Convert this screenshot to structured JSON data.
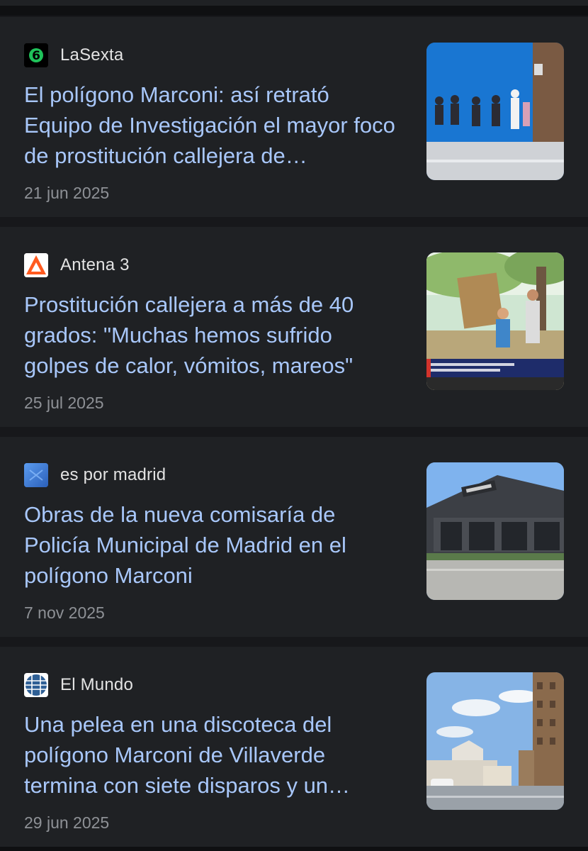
{
  "articles": [
    {
      "publisher": "LaSexta",
      "logo_icon": "lasexta-logo-icon",
      "headline": "El polígono Marconi: así retrató Equipo de Investigación el mayor foco de prostitución callejera de…",
      "date": "21 jun 2025"
    },
    {
      "publisher": "Antena 3",
      "logo_icon": "antena3-logo-icon",
      "headline": "Prostitución callejera a más de 40 grados: \"Muchas hemos sufrido golpes de calor, vómitos, mareos\"",
      "date": "25 jul 2025"
    },
    {
      "publisher": "es por madrid",
      "logo_icon": "esmadrid-logo-icon",
      "headline": "Obras de la nueva comisaría de Policía Municipal de Madrid en el polígono Marconi",
      "date": "7 nov 2025"
    },
    {
      "publisher": "El Mundo",
      "logo_icon": "elmundo-logo-icon",
      "headline": "Una pelea en una discoteca del polígono Marconi de Villaverde termina con siete disparos y un…",
      "date": "29 jun 2025"
    }
  ],
  "colors": {
    "background": "#17181b",
    "card": "#1f2124",
    "headline": "#a8c7fa",
    "publisher": "#e3e3e3",
    "date": "#8e9196"
  }
}
